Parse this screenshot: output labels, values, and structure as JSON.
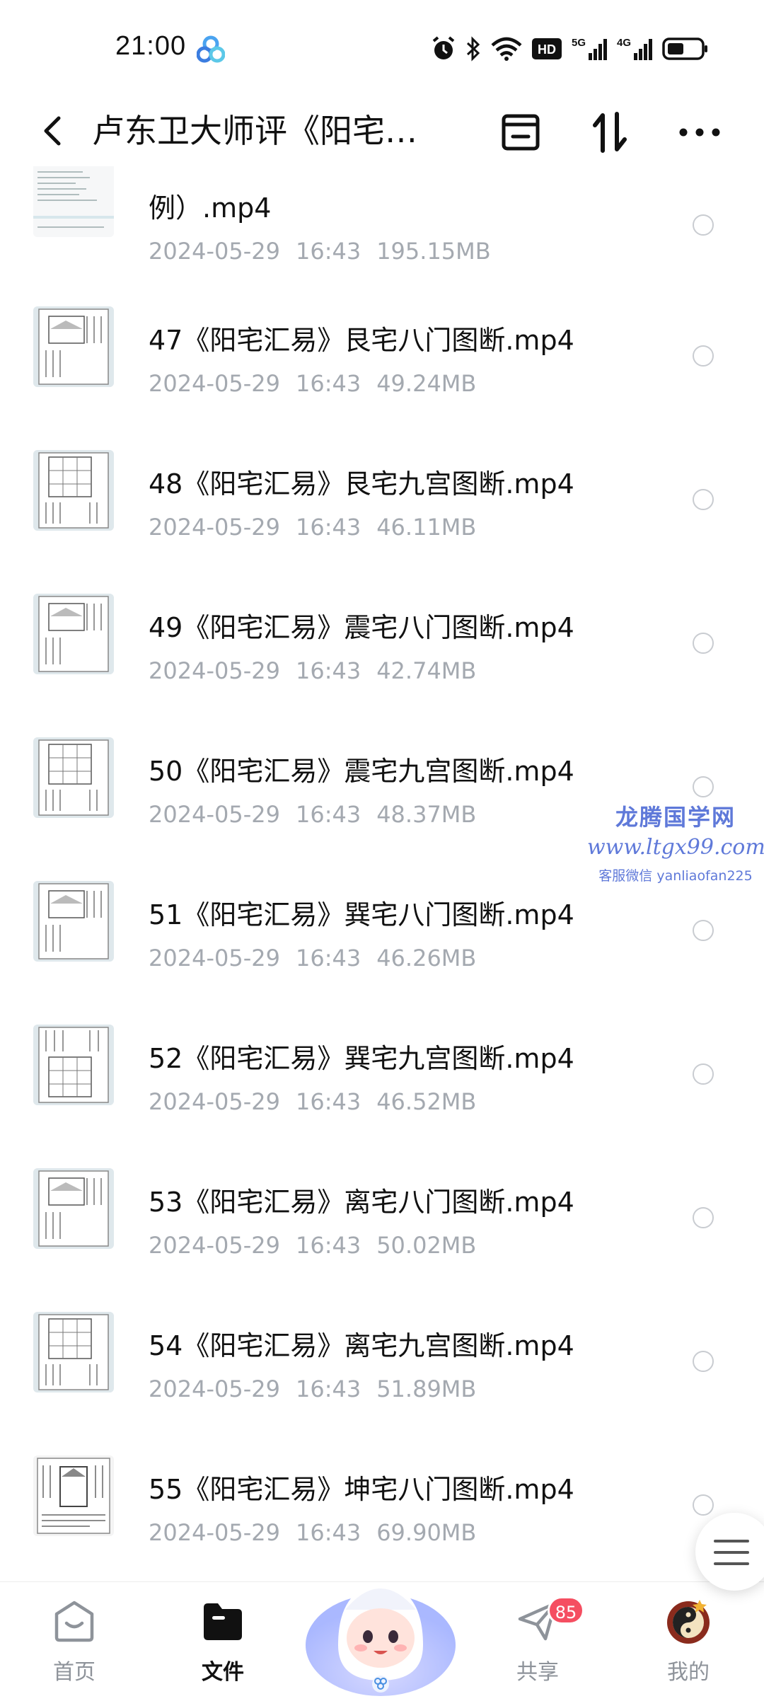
{
  "status_bar": {
    "time": "21:00",
    "icons": [
      "cloud-app-icon",
      "alarm-icon",
      "bluetooth-icon",
      "wifi-icon",
      "hd-icon",
      "signal-5g-icon",
      "signal-4g-icon",
      "battery-icon"
    ],
    "hd_label": "HD",
    "net1": "5G",
    "net2": "4G"
  },
  "header": {
    "title": "卢东卫大师评《阳宅…",
    "icons": [
      "back-icon",
      "archive-icon",
      "sort-icon",
      "more-icon"
    ]
  },
  "files": [
    {
      "name": "例）.mp4",
      "date": "2024-05-29",
      "time": "16:43",
      "size": "195.15MB",
      "partial": true
    },
    {
      "name": "47《阳宅汇易》艮宅八门图断.mp4",
      "date": "2024-05-29",
      "time": "16:43",
      "size": "49.24MB"
    },
    {
      "name": "48《阳宅汇易》艮宅九宫图断.mp4",
      "date": "2024-05-29",
      "time": "16:43",
      "size": "46.11MB"
    },
    {
      "name": "49《阳宅汇易》震宅八门图断.mp4",
      "date": "2024-05-29",
      "time": "16:43",
      "size": "42.74MB"
    },
    {
      "name": "50《阳宅汇易》震宅九宫图断.mp4",
      "date": "2024-05-29",
      "time": "16:43",
      "size": "48.37MB"
    },
    {
      "name": "51《阳宅汇易》巽宅八门图断.mp4",
      "date": "2024-05-29",
      "time": "16:43",
      "size": "46.26MB"
    },
    {
      "name": "52《阳宅汇易》巽宅九宫图断.mp4",
      "date": "2024-05-29",
      "time": "16:43",
      "size": "46.52MB"
    },
    {
      "name": "53《阳宅汇易》离宅八门图断.mp4",
      "date": "2024-05-29",
      "time": "16:43",
      "size": "50.02MB"
    },
    {
      "name": "54《阳宅汇易》离宅九宫图断.mp4",
      "date": "2024-05-29",
      "time": "16:43",
      "size": "51.89MB"
    },
    {
      "name": "55《阳宅汇易》坤宅八门图断.mp4",
      "date": "2024-05-29",
      "time": "16:43",
      "size": "69.90MB"
    }
  ],
  "watermark": {
    "line1": "龙腾国学网",
    "line2": "www.ltgx99.com",
    "line3": "客服微信 yanliaofan225"
  },
  "bottom_nav": {
    "items": [
      {
        "label": "首页",
        "icon": "home-icon",
        "active": false
      },
      {
        "label": "文件",
        "icon": "folder-icon",
        "active": true
      },
      {
        "label": "共享",
        "icon": "share-icon",
        "active": false,
        "badge": "85"
      },
      {
        "label": "我的",
        "icon": "avatar-icon",
        "active": false
      }
    ]
  },
  "colors": {
    "text_primary": "#111111",
    "text_secondary": "#a4a9b0",
    "badge": "#f54e61",
    "watermark": "#5f79d9"
  }
}
